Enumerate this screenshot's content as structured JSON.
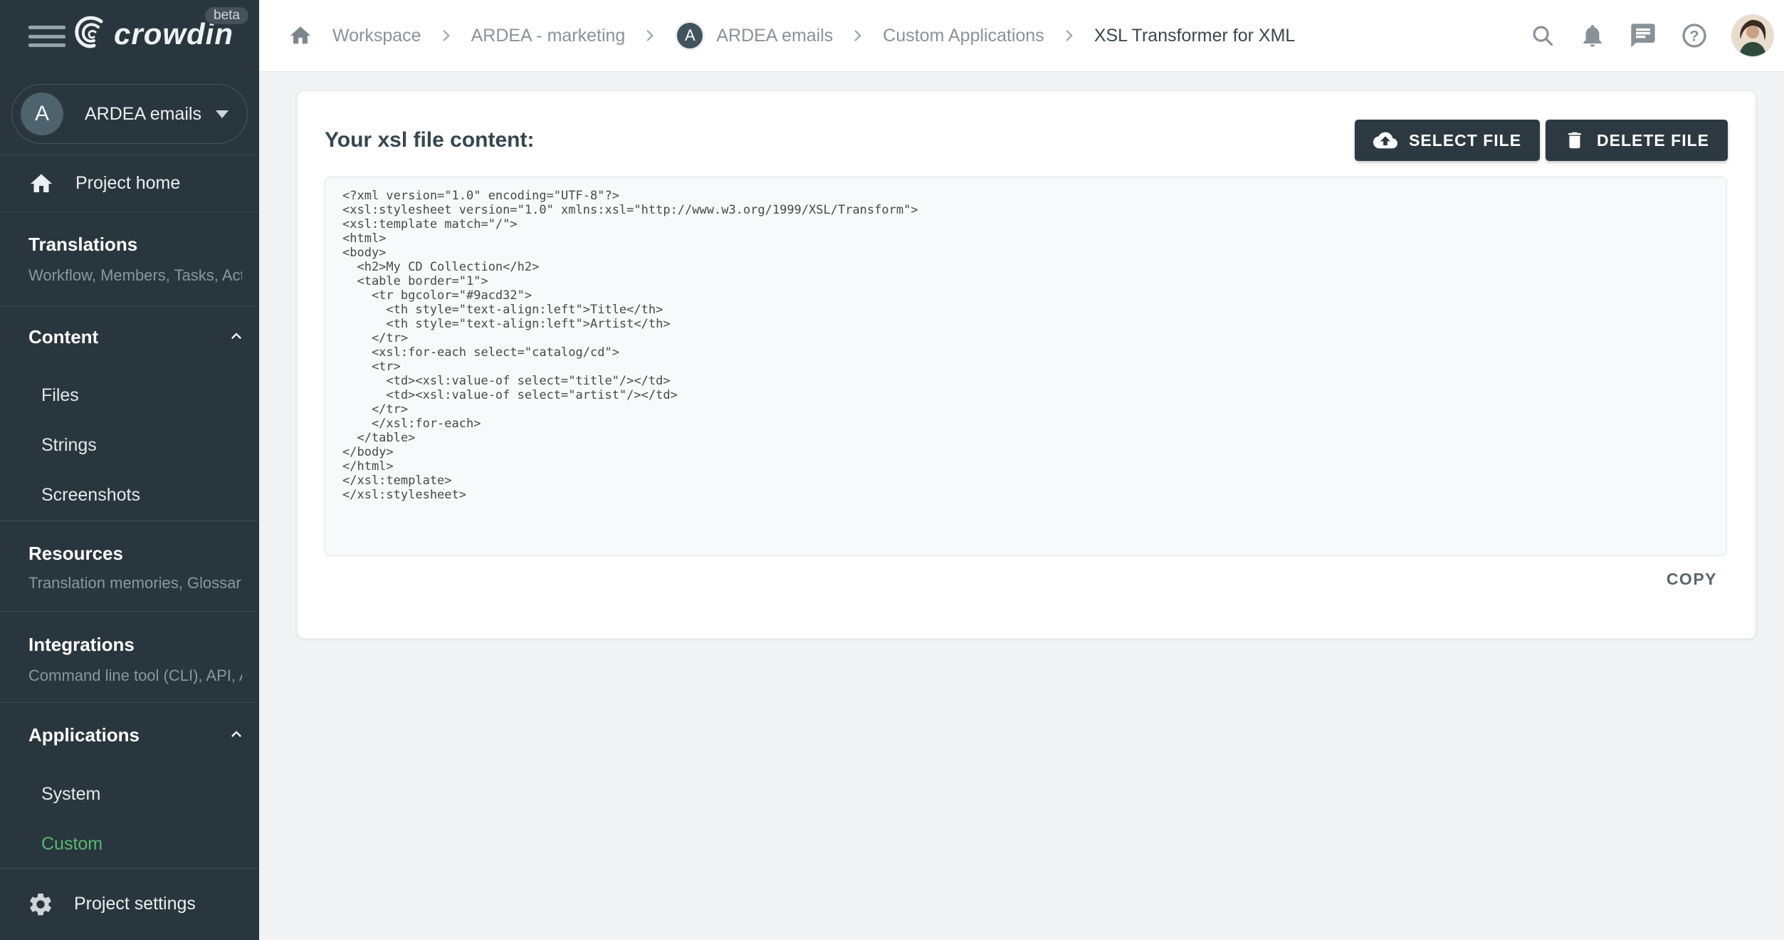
{
  "sidebar": {
    "logo": {
      "text": "crowdin",
      "beta": "beta"
    },
    "project_selector": {
      "initial": "A",
      "name": "ARDEA emails"
    },
    "project_home_label": "Project home",
    "translations": {
      "title": "Translations",
      "subtitle": "Workflow, Members, Tasks, Act…"
    },
    "content": {
      "title": "Content",
      "items": [
        "Files",
        "Strings",
        "Screenshots"
      ]
    },
    "resources": {
      "title": "Resources",
      "subtitle": "Translation memories, Glossari…"
    },
    "integrations": {
      "title": "Integrations",
      "subtitle": "Command line tool (CLI), API, A…"
    },
    "applications": {
      "title": "Applications",
      "items": [
        "System",
        "Custom"
      ],
      "active_item": "Custom"
    },
    "project_settings_label": "Project settings"
  },
  "topbar": {
    "breadcrumb": [
      "Workspace",
      "ARDEA - marketing",
      "ARDEA emails",
      "Custom Applications",
      "XSL Transformer for XML"
    ],
    "project_initial": "A"
  },
  "main": {
    "heading": "Your xsl file content:",
    "select_file_label": "SELECT FILE",
    "delete_file_label": "DELETE FILE",
    "copy_label": "COPY",
    "code": "<?xml version=\"1.0\" encoding=\"UTF-8\"?>\n<xsl:stylesheet version=\"1.0\" xmlns:xsl=\"http://www.w3.org/1999/XSL/Transform\">\n<xsl:template match=\"/\">\n<html>\n<body>\n  <h2>My CD Collection</h2>\n  <table border=\"1\">\n    <tr bgcolor=\"#9acd32\">\n      <th style=\"text-align:left\">Title</th>\n      <th style=\"text-align:left\">Artist</th>\n    </tr>\n    <xsl:for-each select=\"catalog/cd\">\n    <tr>\n      <td><xsl:value-of select=\"title\"/></td>\n      <td><xsl:value-of select=\"artist\"/></td>\n    </tr>\n    </xsl:for-each>\n  </table>\n</body>\n</html>\n</xsl:template>\n</xsl:stylesheet>"
  },
  "colors": {
    "sidebar_bg": "#2a363d",
    "accent_green": "#56b96e",
    "button_bg": "#2d3940",
    "topbar_bg": "#ffffff",
    "page_bg": "#f1f3f4"
  }
}
